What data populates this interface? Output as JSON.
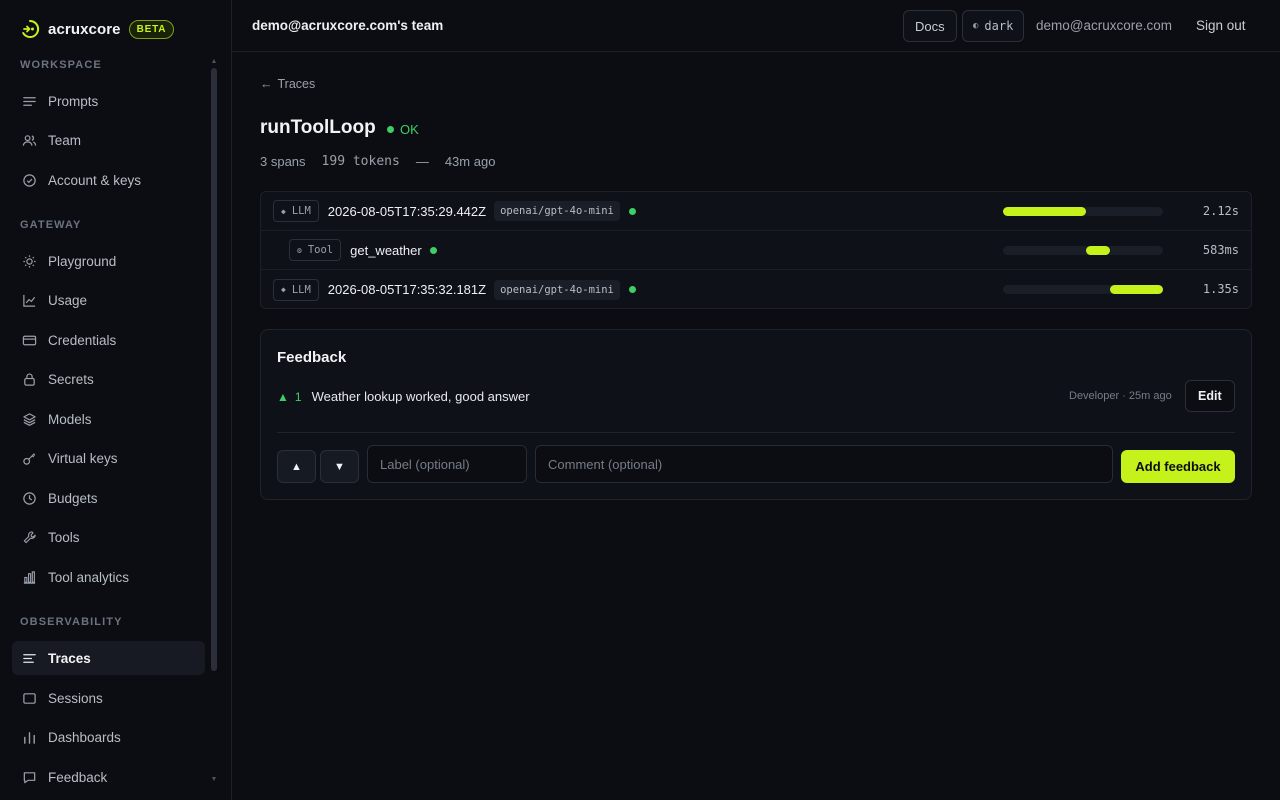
{
  "brand": {
    "name": "acruxcore",
    "badge": "BETA",
    "accent": "#c6f21c"
  },
  "sidebar": {
    "sections": [
      {
        "title": "WORKSPACE",
        "items": [
          {
            "label": "Prompts",
            "icon": "list-icon"
          },
          {
            "label": "Team",
            "icon": "users-icon"
          },
          {
            "label": "Account & keys",
            "icon": "check-circle-icon"
          }
        ]
      },
      {
        "title": "GATEWAY",
        "items": [
          {
            "label": "Playground",
            "icon": "sun-icon"
          },
          {
            "label": "Usage",
            "icon": "line-chart-icon"
          },
          {
            "label": "Credentials",
            "icon": "card-icon"
          },
          {
            "label": "Secrets",
            "icon": "lock-icon"
          },
          {
            "label": "Models",
            "icon": "layers-icon"
          },
          {
            "label": "Virtual keys",
            "icon": "key-icon"
          },
          {
            "label": "Budgets",
            "icon": "clock-icon"
          },
          {
            "label": "Tools",
            "icon": "wrench-icon"
          },
          {
            "label": "Tool analytics",
            "icon": "bar-chart-icon"
          }
        ]
      },
      {
        "title": "OBSERVABILITY",
        "items": [
          {
            "label": "Traces",
            "icon": "traces-icon",
            "active": true
          },
          {
            "label": "Sessions",
            "icon": "window-icon"
          },
          {
            "label": "Dashboards",
            "icon": "bar-chart-icon"
          },
          {
            "label": "Feedback",
            "icon": "message-icon"
          }
        ]
      }
    ]
  },
  "topbar": {
    "team": "demo@acruxcore.com's team",
    "docs": "Docs",
    "theme": "dark",
    "email": "demo@acruxcore.com",
    "sign_out": "Sign out"
  },
  "trace": {
    "back": "Traces",
    "title": "runToolLoop",
    "status": "OK",
    "span_count": "3 spans",
    "tokens": "199 tokens",
    "separator": "—",
    "age": "43m ago",
    "spans": [
      {
        "kind": "LLM",
        "name": "2026-08-05T17:35:29.442Z",
        "model": "openai/gpt-4o-mini",
        "status": "ok",
        "duration": "2.12s",
        "bar_start": 0.0,
        "bar_fraction": 0.52,
        "indent": false
      },
      {
        "kind": "Tool",
        "name": "get_weather",
        "model": "",
        "status": "ok",
        "duration": "583ms",
        "bar_start": 0.52,
        "bar_fraction": 0.15,
        "indent": true
      },
      {
        "kind": "LLM",
        "name": "2026-08-05T17:35:32.181Z",
        "model": "openai/gpt-4o-mini",
        "status": "ok",
        "duration": "1.35s",
        "bar_start": 0.67,
        "bar_fraction": 0.33,
        "indent": false
      }
    ]
  },
  "feedback": {
    "title": "Feedback",
    "entries": [
      {
        "direction": "▲",
        "score": "1",
        "comment": "Weather lookup worked, good answer",
        "meta": "Developer · 25m ago",
        "edit": "Edit"
      }
    ],
    "form": {
      "up": "▲",
      "down": "▼",
      "label_placeholder": "Label (optional)",
      "comment_placeholder": "Comment (optional)",
      "submit": "Add feedback"
    }
  }
}
